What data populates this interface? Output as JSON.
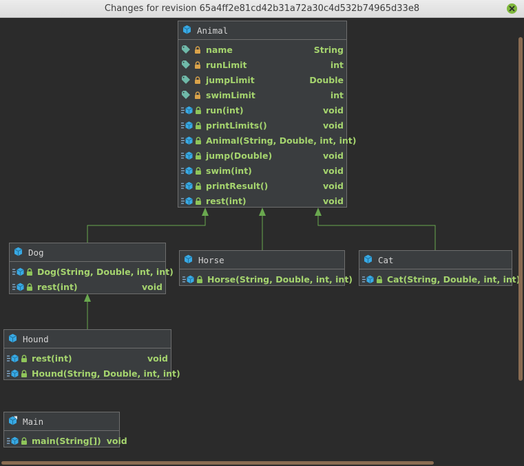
{
  "window": {
    "title": "Changes for revision 65a4ff2e81cd42b31a72a30c4d532b74965d33e8"
  },
  "colors": {
    "background": "#2b2b2b",
    "node_bg": "#3a3d3f",
    "member_text": "#a5d46e",
    "class_icon": "#38a9e4",
    "edge": "#6aa84f"
  },
  "classes": {
    "animal": {
      "name": "Animal",
      "members": [
        {
          "kind": "field",
          "name": "name",
          "type": "String"
        },
        {
          "kind": "field",
          "name": "runLimit",
          "type": "int"
        },
        {
          "kind": "field",
          "name": "jumpLimit",
          "type": "Double"
        },
        {
          "kind": "field",
          "name": "swimLimit",
          "type": "int"
        },
        {
          "kind": "method",
          "name": "run(int)",
          "type": "void"
        },
        {
          "kind": "method",
          "name": "printLimits()",
          "type": "void"
        },
        {
          "kind": "method",
          "name": "Animal(String, Double, int, int)",
          "type": ""
        },
        {
          "kind": "method",
          "name": "jump(Double)",
          "type": "void"
        },
        {
          "kind": "method",
          "name": "swim(int)",
          "type": "void"
        },
        {
          "kind": "method",
          "name": "printResult()",
          "type": "void"
        },
        {
          "kind": "method",
          "name": "rest(int)",
          "type": "void"
        }
      ]
    },
    "dog": {
      "name": "Dog",
      "members": [
        {
          "kind": "method",
          "name": "Dog(String, Double, int, int)",
          "type": ""
        },
        {
          "kind": "method",
          "name": "rest(int)",
          "type": "void"
        }
      ]
    },
    "horse": {
      "name": "Horse",
      "members": [
        {
          "kind": "method",
          "name": "Horse(String, Double, int, int)",
          "type": ""
        }
      ]
    },
    "cat": {
      "name": "Cat",
      "members": [
        {
          "kind": "method",
          "name": "Cat(String, Double, int, int)",
          "type": ""
        }
      ]
    },
    "hound": {
      "name": "Hound",
      "members": [
        {
          "kind": "method",
          "name": "rest(int)",
          "type": "void"
        },
        {
          "kind": "method",
          "name": "Hound(String, Double, int, int)",
          "type": ""
        }
      ]
    },
    "main": {
      "name": "Main",
      "members": [
        {
          "kind": "method",
          "name": "main(String[])",
          "type": "void"
        }
      ]
    }
  },
  "edges": [
    {
      "from": "Dog",
      "to": "Animal"
    },
    {
      "from": "Horse",
      "to": "Animal"
    },
    {
      "from": "Cat",
      "to": "Animal"
    },
    {
      "from": "Hound",
      "to": "Dog"
    }
  ]
}
